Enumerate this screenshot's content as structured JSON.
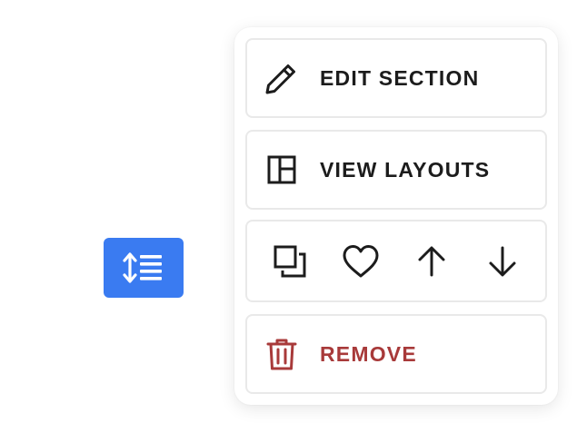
{
  "trigger": {
    "icon": "line-height-icon",
    "color": "#3a7bf1"
  },
  "menu": {
    "edit_label": "EDIT SECTION",
    "edit_icon": "pencil-icon",
    "layouts_label": "VIEW LAYOUTS",
    "layouts_icon": "layout-icon",
    "actions": [
      {
        "icon": "duplicate-icon"
      },
      {
        "icon": "heart-icon"
      },
      {
        "icon": "arrow-up-icon"
      },
      {
        "icon": "arrow-down-icon"
      }
    ],
    "remove_label": "REMOVE",
    "remove_icon": "trash-icon",
    "remove_color": "#a83a3a"
  }
}
